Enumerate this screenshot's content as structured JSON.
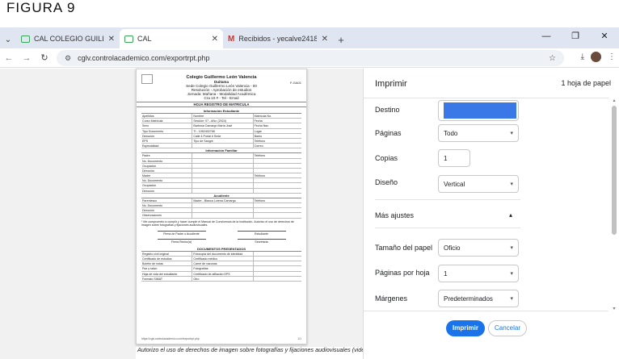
{
  "caption": "FIGURA 9",
  "tabs": [
    {
      "title": "CAL COLEGIO GUILLERMO LEON",
      "icon": "green-square-icon",
      "active": false
    },
    {
      "title": "CAL",
      "icon": "green-square-icon",
      "active": true
    },
    {
      "title": "Recibidos - yecalve2418@gma",
      "icon": "gmail-icon",
      "active": false
    }
  ],
  "address": {
    "url": "cglv.controlacademico.com/exportrpt.php"
  },
  "document": {
    "school_name": "Colegio Guillermo León Valencia",
    "school_place": "Duitama",
    "header_lines": [
      "Sede Colegio Guillermo León Valencia - 00",
      "Resolución - Aprobación de estudios",
      "Jornada: Mañana - Modalidad Académica",
      "Cra 10 # - Tel - Email"
    ],
    "form_code": "F-GA01",
    "subtitle": "HOJA REGISTRO DE MATRICULA",
    "section_student": "Información Estudiante",
    "section_family": "Información Familiar",
    "section_guardian": "Acudiente",
    "section_docs": "DOCUMENTOS PRESENTADOS",
    "student_rows": [
      [
        "Apellidos",
        "Nombre",
        "Matrícula No."
      ],
      [
        "Curso Matrícula",
        "Sección: 07 - Año: (2024)",
        "Fecha"
      ],
      [
        "Sexo",
        "Barbosa Camargo María José",
        "Fecha Nac."
      ],
      [
        "Tipo Documento",
        "TI - 1052402768",
        "Lugar"
      ],
      [
        "Dirección",
        "Calle 4 Portal # Sede",
        "Barrio"
      ],
      [
        "EPS",
        "Tipo de Sangre",
        "Teléfono"
      ],
      [
        "Especialidad",
        "",
        "Correo"
      ]
    ],
    "family_rows": [
      [
        "Padre",
        "",
        "Teléfono"
      ],
      [
        "No. Documento",
        "",
        ""
      ],
      [
        "Ocupación",
        "",
        ""
      ],
      [
        "Dirección",
        "",
        ""
      ],
      [
        "Madre",
        "",
        "Teléfono"
      ],
      [
        "No. Documento",
        "",
        ""
      ],
      [
        "Ocupación",
        "",
        ""
      ],
      [
        "Dirección",
        "",
        ""
      ]
    ],
    "guardian_rows": [
      [
        "Parentesco",
        "Madre - Blanca Lorena Camargo",
        "Teléfono"
      ],
      [
        "No. Documento",
        "",
        ""
      ],
      [
        "Dirección",
        "",
        ""
      ],
      [
        "Observaciones",
        "",
        ""
      ]
    ],
    "consent_text": "* Me comprometo a cumplir y hacer cumplir el Manual de Convivencia de la Institución. Autorizo el uso de derechos de imagen sobre fotografías y fijaciones audiovisuales.",
    "signature_left": "Firma de Padre o Acudiente",
    "signature_right": "Estudiante",
    "signature_left2": "Firma Rector(a)",
    "signature_right2": "Secretaria",
    "doc_items": [
      [
        "Registro civil original",
        "Fotocopia del documento de identidad"
      ],
      [
        "Certificado de estudios",
        "Certificado médico"
      ],
      [
        "Boletín de notas",
        "Carné de vacunas"
      ],
      [
        "Paz y salvo",
        "Fotografías"
      ],
      [
        "Hoja de vida del estudiante",
        "Certificado de afiliación EPS"
      ],
      [
        "Formato SIMAT",
        "Otro"
      ]
    ],
    "footer_left": "https://cglv.controlacademico.com/exportrpt.php",
    "footer_right": "1/1"
  },
  "below_document_text": "Autorizo el uso de derechos de imagen sobre fotografías y fijaciones audiovisuales (videos) que se realicen a mi acudido con fines pedagógicos por parte de la Institución.",
  "print_panel": {
    "title": "Imprimir",
    "sheet_count": "1 hoja de papel",
    "destination_label": "Destino",
    "pages_label": "Páginas",
    "pages_value": "Todo",
    "copies_label": "Copias",
    "copies_value": "1",
    "layout_label": "Diseño",
    "layout_value": "Vertical",
    "more_settings_label": "Más ajustes",
    "paper_size_label": "Tamaño del papel",
    "paper_size_value": "Oficio",
    "pages_per_sheet_label": "Páginas por hoja",
    "pages_per_sheet_value": "1",
    "margins_label": "Márgenes",
    "margins_value": "Predeterminados",
    "print_button": "Imprimir",
    "cancel_button": "Cancelar",
    "accent_color": "#1a73e8",
    "redaction_color": "#3b78e7"
  }
}
